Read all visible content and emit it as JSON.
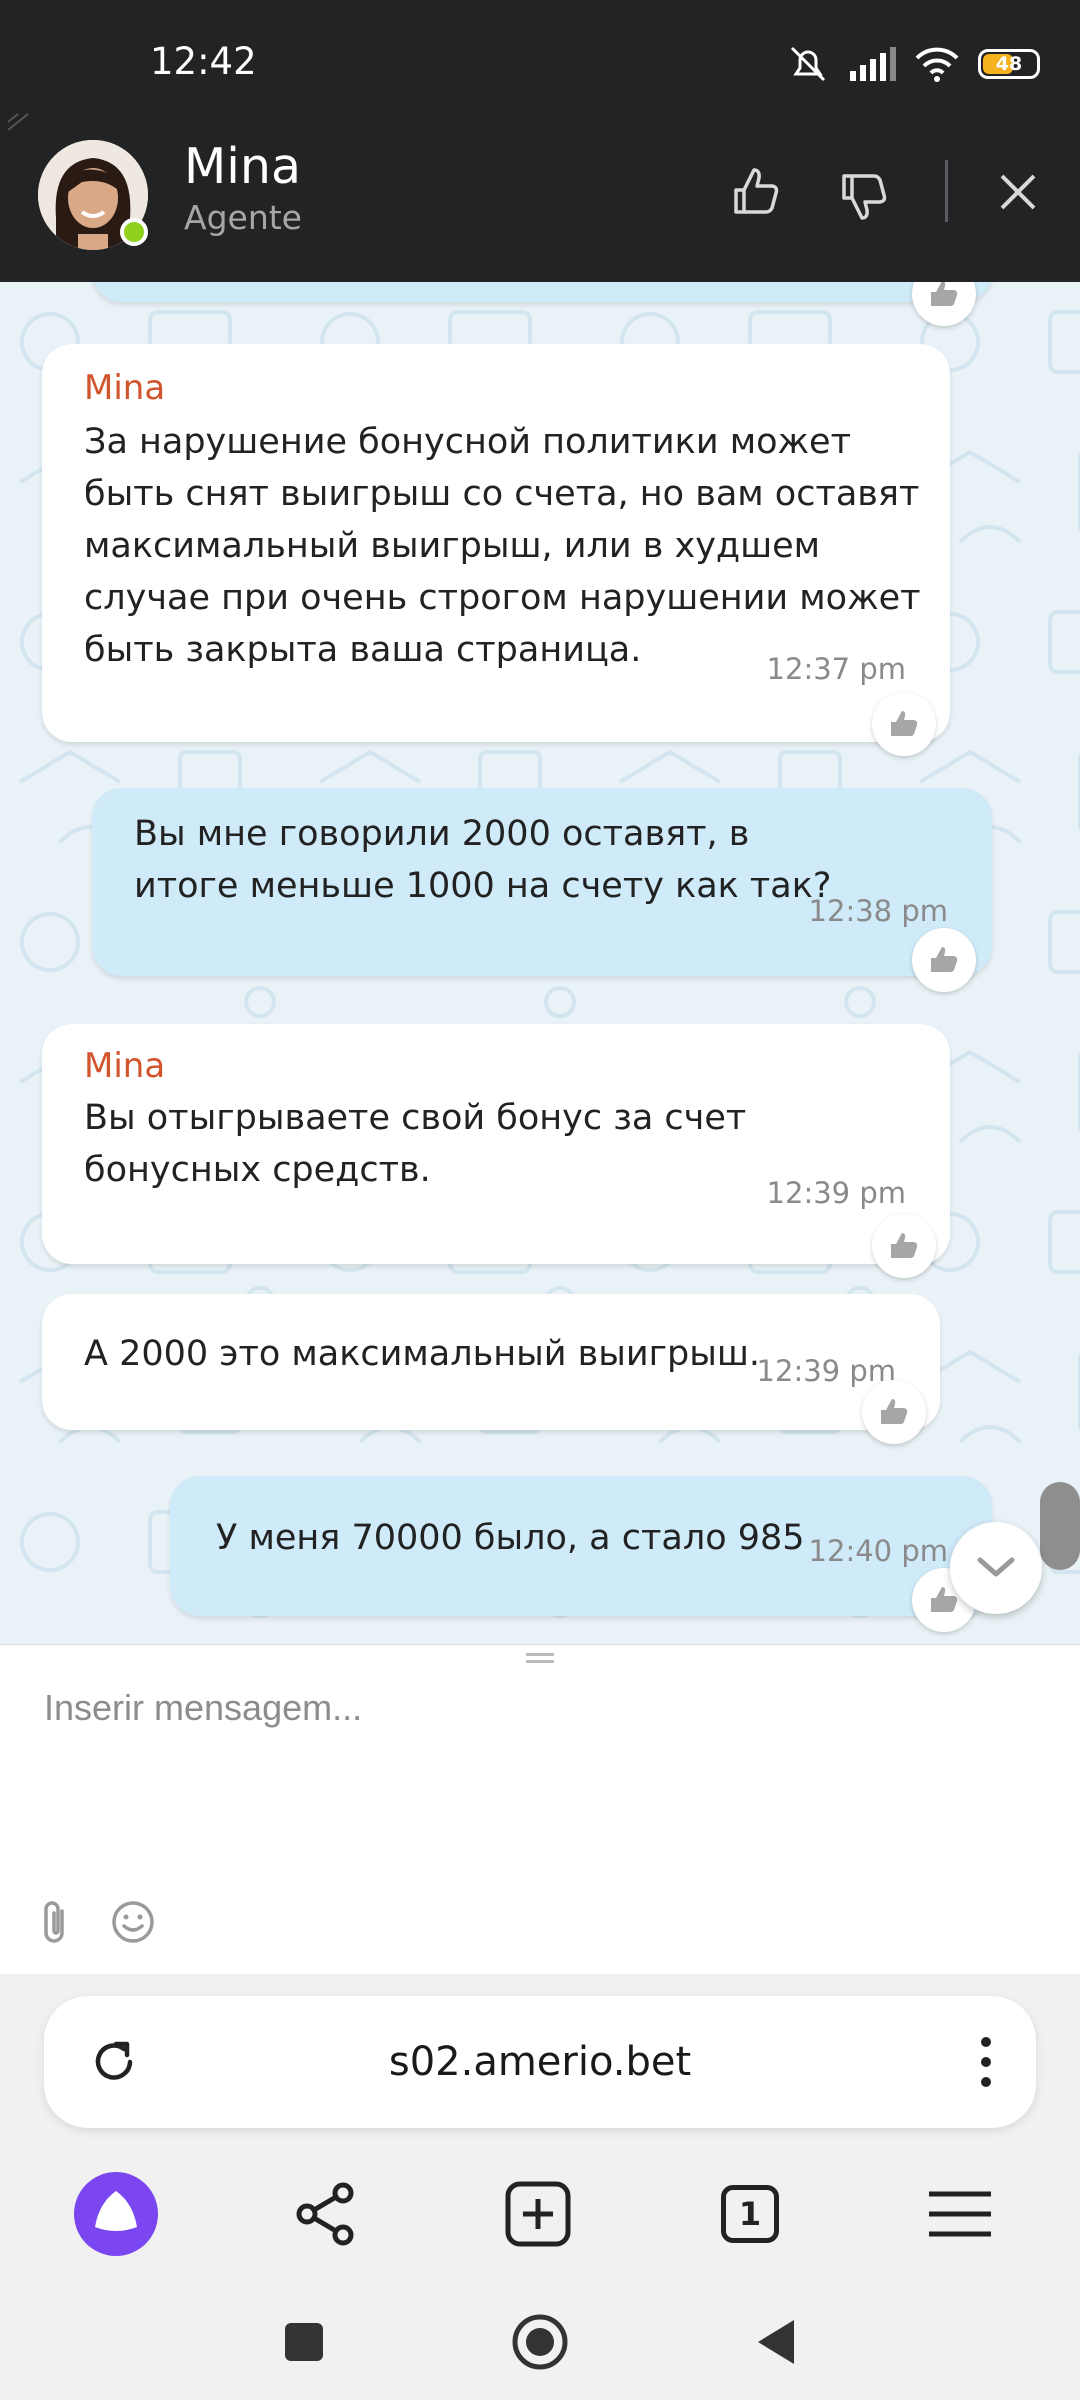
{
  "status_bar": {
    "time": "12:42",
    "battery": "48"
  },
  "chat_header": {
    "name": "Mina",
    "role": "Agente"
  },
  "messages": [
    {
      "sender": "Mina",
      "text": "За нарушение бонусной политики может быть снят выигрыш со счета, но вам оставят максимальный выигрыш, или в худшем случае при очень строгом нарушении может быть закрыта ваша страница.",
      "time": "12:37 pm"
    },
    {
      "text": "Вы мне говорили 2000 оставят, в итоге меньше 1000 на счету как так?",
      "time": "12:38 pm"
    },
    {
      "sender": "Mina",
      "text": "Вы отыгрываете свой бонус за счет бонусных средств.",
      "time": "12:39 pm"
    },
    {
      "text": "А 2000 это максимальный выигрыш.",
      "time": "12:39 pm"
    },
    {
      "text": "У меня 70000 было, а стало 985",
      "time": "12:40 pm"
    }
  ],
  "composer": {
    "placeholder": "Inserir mensagem..."
  },
  "browser": {
    "url": "s02.amerio.bet",
    "tab_count": "1"
  },
  "colors": {
    "header_bg": "#222325",
    "sender_name": "#d2542c",
    "outgoing_bubble": "#cfeaf8",
    "online_status": "#8fd11c",
    "assistant_button": "#7b46f0"
  }
}
